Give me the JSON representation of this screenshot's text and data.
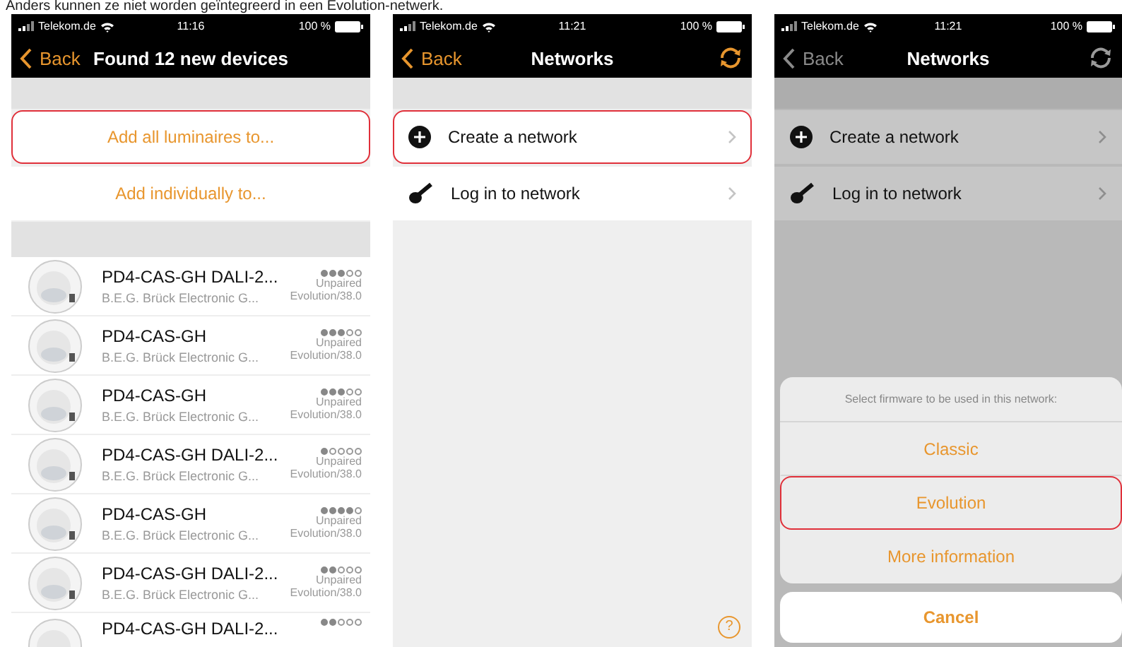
{
  "caption": "Anders kunnen ze niet worden geïntegreerd in een Evolution-netwerk.",
  "screens": [
    {
      "kind": "devices",
      "status": {
        "carrier": "Telekom.de",
        "time": "11:16",
        "battery": "100 %"
      },
      "nav": {
        "back": "Back",
        "title": "Found 12 new devices",
        "back_disabled": false
      },
      "actions": [
        {
          "label": "Add all luminaires to...",
          "highlighted": true
        },
        {
          "label": "Add individually to...",
          "highlighted": false
        }
      ],
      "devices": [
        {
          "name": "PD4-CAS-GH DALI-2...",
          "vendor": "B.E.G. Brück Electronic G...",
          "stars": 3,
          "state": "Unpaired",
          "firmware": "Evolution/38.0"
        },
        {
          "name": "PD4-CAS-GH",
          "vendor": "B.E.G. Brück Electronic G...",
          "stars": 3,
          "state": "Unpaired",
          "firmware": "Evolution/38.0"
        },
        {
          "name": "PD4-CAS-GH",
          "vendor": "B.E.G. Brück Electronic G...",
          "stars": 3,
          "state": "Unpaired",
          "firmware": "Evolution/38.0"
        },
        {
          "name": "PD4-CAS-GH DALI-2...",
          "vendor": "B.E.G. Brück Electronic G...",
          "stars": 1,
          "state": "Unpaired",
          "firmware": "Evolution/38.0"
        },
        {
          "name": "PD4-CAS-GH",
          "vendor": "B.E.G. Brück Electronic G...",
          "stars": 4,
          "state": "Unpaired",
          "firmware": "Evolution/38.0"
        },
        {
          "name": "PD4-CAS-GH DALI-2...",
          "vendor": "B.E.G. Brück Electronic G...",
          "stars": 2,
          "state": "Unpaired",
          "firmware": "Evolution/38.0"
        },
        {
          "name": "PD4-CAS-GH DALI-2...",
          "stars": 2
        }
      ]
    },
    {
      "kind": "networks",
      "dimmed": false,
      "status": {
        "carrier": "Telekom.de",
        "time": "11:21",
        "battery": "100 %"
      },
      "nav": {
        "back": "Back",
        "title": "Networks",
        "back_disabled": false
      },
      "options": [
        {
          "kind": "create",
          "label": "Create a network",
          "highlighted": true
        },
        {
          "kind": "login",
          "label": "Log in to network",
          "highlighted": false
        }
      ],
      "help": "?"
    },
    {
      "kind": "networks",
      "dimmed": true,
      "status": {
        "carrier": "Telekom.de",
        "time": "11:21",
        "battery": "100 %"
      },
      "nav": {
        "back": "Back",
        "title": "Networks",
        "back_disabled": true
      },
      "options": [
        {
          "kind": "create",
          "label": "Create a network",
          "highlighted": false
        },
        {
          "kind": "login",
          "label": "Log in to network",
          "highlighted": false
        }
      ],
      "sheet": {
        "title": "Select firmware to be used in this network:",
        "options": [
          {
            "label": "Classic",
            "highlighted": false
          },
          {
            "label": "Evolution",
            "highlighted": true
          },
          {
            "label": "More information",
            "highlighted": false
          }
        ],
        "cancel": "Cancel"
      }
    }
  ]
}
